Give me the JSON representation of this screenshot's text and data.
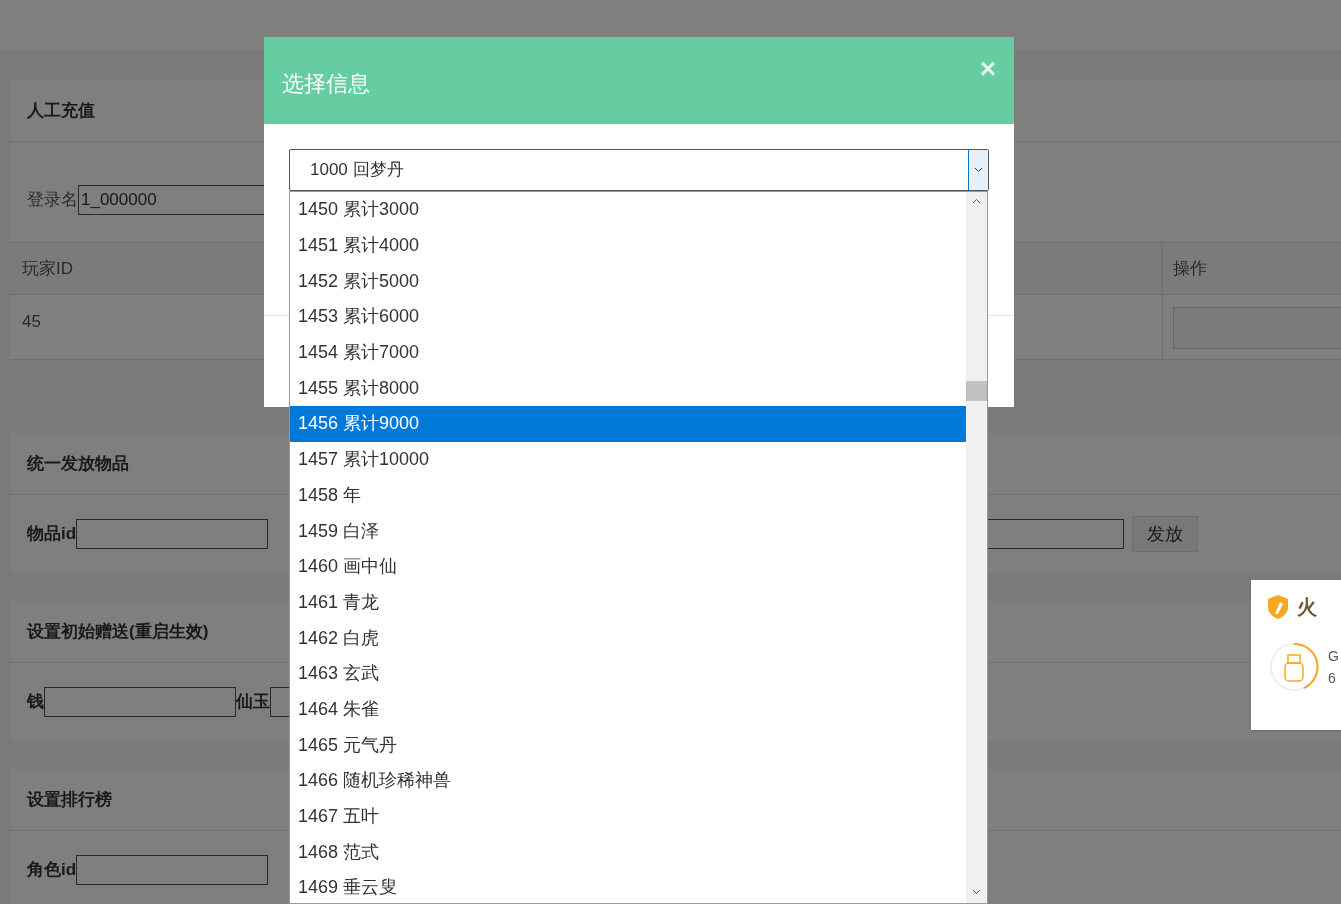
{
  "sections": [
    {
      "title": "人工充值",
      "fields": [
        {
          "kind": "labeled",
          "label": "登录名",
          "value": "1_000000"
        }
      ],
      "table": {
        "columns": [
          "玩家ID",
          "操作"
        ],
        "rows": [
          [
            "45"
          ]
        ]
      }
    },
    {
      "title": "统一发放物品",
      "fields": [
        {
          "kind": "labeled",
          "label": "物品id"
        },
        {
          "kind": "bare"
        }
      ],
      "button": "发放"
    },
    {
      "title": "设置初始赠送(重启生效)",
      "fields": [
        {
          "kind": "labeled",
          "label": "钱"
        },
        {
          "kind": "labeled",
          "label": "仙玉"
        }
      ]
    },
    {
      "title": "设置排行榜",
      "fields": [
        {
          "kind": "labeled",
          "label": "角色id"
        }
      ]
    }
  ],
  "modal": {
    "title": "选择信息",
    "close": "×",
    "select": {
      "value": "1000 回梦丹",
      "options": [
        {
          "label": "1450 累计3000",
          "selected": false
        },
        {
          "label": "1451 累计4000",
          "selected": false
        },
        {
          "label": "1452 累计5000",
          "selected": false
        },
        {
          "label": "1453 累计6000",
          "selected": false
        },
        {
          "label": "1454 累计7000",
          "selected": false
        },
        {
          "label": "1455 累计8000",
          "selected": false
        },
        {
          "label": "1456 累计9000",
          "selected": true
        },
        {
          "label": "1457 累计10000",
          "selected": false
        },
        {
          "label": "1458 年",
          "selected": false
        },
        {
          "label": "1459 白泽",
          "selected": false
        },
        {
          "label": "1460 画中仙",
          "selected": false
        },
        {
          "label": "1461 青龙",
          "selected": false
        },
        {
          "label": "1462 白虎",
          "selected": false
        },
        {
          "label": "1463 玄武",
          "selected": false
        },
        {
          "label": "1464 朱雀",
          "selected": false
        },
        {
          "label": "1465 元气丹",
          "selected": false
        },
        {
          "label": "1466 随机珍稀神兽",
          "selected": false
        },
        {
          "label": "1467 五叶",
          "selected": false
        },
        {
          "label": "1468 范式",
          "selected": false
        },
        {
          "label": "1469 垂云叟",
          "selected": false
        }
      ]
    }
  },
  "notification": {
    "title": "火",
    "lines": [
      "G",
      "6"
    ]
  }
}
